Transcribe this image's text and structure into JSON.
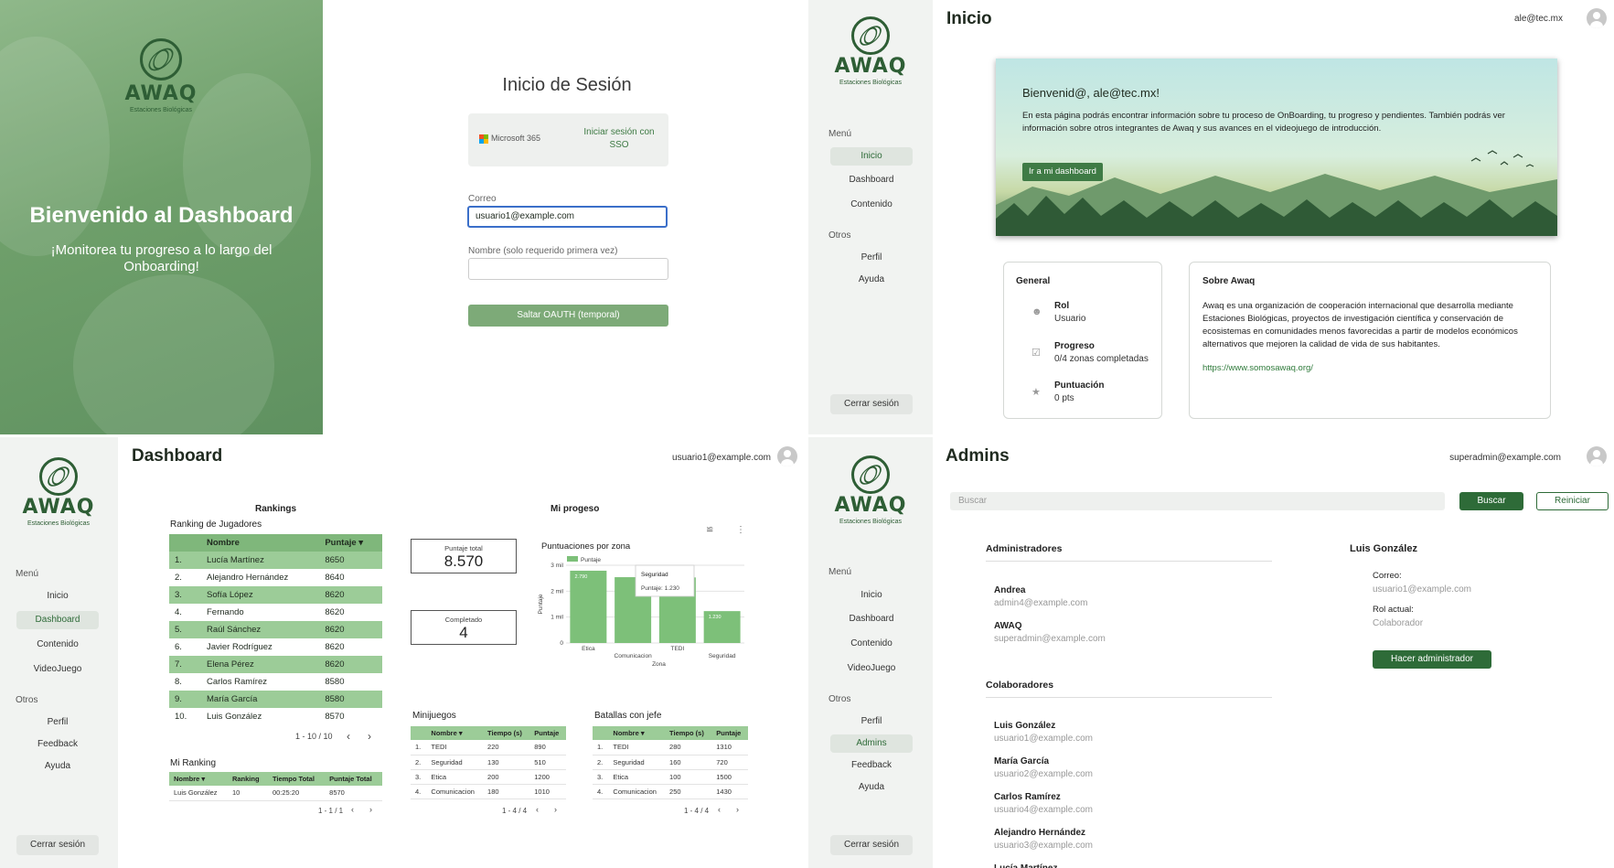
{
  "brand": {
    "name": "AWAQ",
    "tagline": "Estaciones Biológicas"
  },
  "login": {
    "hero_title": "Bienvenido al Dashboard",
    "hero_subtitle": "¡Monitorea tu progreso a lo largo del Onboarding!",
    "title": "Inicio de Sesión",
    "ms_label": "Microsoft 365",
    "sso_label": "Iniciar sesión con SSO",
    "email_label": "Correo",
    "email_value": "usuario1@example.com",
    "name_label": "Nombre (solo requerido primera vez)",
    "name_value": "",
    "skip_button": "Saltar OAUTH (temporal)"
  },
  "inicio": {
    "title": "Inicio",
    "user_email": "ale@tec.mx",
    "sidebar": {
      "menu_label": "Menú",
      "menu_items": [
        "Inicio",
        "Dashboard",
        "Contenido"
      ],
      "others_label": "Otros",
      "other_items": [
        "Perfil",
        "Ayuda"
      ],
      "logout": "Cerrar sesión"
    },
    "banner": {
      "greeting": "Bienvenid@, ale@tec.mx!",
      "text": "En esta página podrás encontrar información sobre tu proceso de OnBoarding, tu progreso y pendientes. También podrás ver información sobre otros integrantes de Awaq y sus avances en el videojuego de introducción.",
      "button": "Ir a mi dashboard"
    },
    "general": {
      "title": "General",
      "rol_label": "Rol",
      "rol_value": "Usuario",
      "progreso_label": "Progreso",
      "progreso_value": "0/4 zonas completadas",
      "puntuacion_label": "Puntuación",
      "puntuacion_value": "0 pts"
    },
    "about": {
      "title": "Sobre Awaq",
      "text": "Awaq es una organización de cooperación internacional que desarrolla mediante Estaciones Biológicas, proyectos de investigación científica y conservación de ecosistemas en comunidades menos favorecidas a partir de modelos económicos alternativos que mejoren la calidad de vida de sus habitantes.",
      "link": "https://www.somosawaq.org/"
    }
  },
  "dashboard": {
    "title": "Dashboard",
    "user_email": "usuario1@example.com",
    "sidebar": {
      "menu_label": "Menú",
      "menu_items": [
        "Inicio",
        "Dashboard",
        "Contenido",
        "VideoJuego"
      ],
      "others_label": "Otros",
      "other_items": [
        "Perfil",
        "Feedback",
        "Ayuda"
      ],
      "logout": "Cerrar sesión"
    },
    "rankings": {
      "section": "Rankings",
      "subtitle": "Ranking de Jugadores",
      "headers": [
        "Nombre",
        "Puntaje ▾"
      ],
      "rows": [
        [
          "1.",
          "Lucía Martínez",
          "8650"
        ],
        [
          "2.",
          "Alejandro Hernández",
          "8640"
        ],
        [
          "3.",
          "Sofía López",
          "8620"
        ],
        [
          "4.",
          "Fernando",
          "8620"
        ],
        [
          "5.",
          "Raúl Sánchez",
          "8620"
        ],
        [
          "6.",
          "Javier Rodríguez",
          "8620"
        ],
        [
          "7.",
          "Elena Pérez",
          "8620"
        ],
        [
          "8.",
          "Carlos Ramírez",
          "8580"
        ],
        [
          "9.",
          "María García",
          "8580"
        ],
        [
          "10.",
          "Luis González",
          "8570"
        ]
      ],
      "pager": "1 - 10 / 10"
    },
    "mi_ranking": {
      "title": "Mi Ranking",
      "headers": [
        "Nombre ▾",
        "Ranking",
        "Tiempo Total",
        "Puntaje Total"
      ],
      "rows": [
        [
          "Luis González",
          "10",
          "00:25:20",
          "8570"
        ]
      ],
      "pager": "1 - 1 / 1"
    },
    "progreso": {
      "section": "Mi progeso",
      "total_label": "Puntaje total",
      "total_value": "8.570",
      "done_label": "Completado",
      "done_value": "4"
    },
    "chart_data": {
      "type": "bar",
      "title": "Puntuaciones por zona",
      "xlabel": "Zona",
      "ylabel": "Puntaje",
      "categories": [
        "Etica",
        "Comunicacion",
        "TEDI",
        "Seguridad"
      ],
      "series": [
        {
          "name": "Puntaje",
          "values": [
            2790,
            2540,
            2530,
            1230
          ]
        }
      ],
      "ylim": [
        0,
        3000
      ],
      "yticks": [
        "0",
        "1 mil",
        "2 mil",
        "3 mil"
      ],
      "bar_labels": [
        "2.790",
        "",
        "",
        "1.230"
      ],
      "tooltip": {
        "title": "Seguridad",
        "text": "Puntaje: 1.230"
      },
      "color": "#7dc079",
      "legend": "top-left"
    },
    "minijuegos": {
      "title": "Minijuegos",
      "headers": [
        "Nombre ▾",
        "Tiempo (s)",
        "Puntaje"
      ],
      "rows": [
        [
          "1.",
          "TEDI",
          "220",
          "890"
        ],
        [
          "2.",
          "Seguridad",
          "130",
          "510"
        ],
        [
          "3.",
          "Etica",
          "200",
          "1200"
        ],
        [
          "4.",
          "Comunicacion",
          "180",
          "1010"
        ]
      ],
      "pager": "1 - 4 / 4"
    },
    "batallas": {
      "title": "Batallas con jefe",
      "headers": [
        "Nombre ▾",
        "Tiempo (s)",
        "Puntaje"
      ],
      "rows": [
        [
          "1.",
          "TEDI",
          "280",
          "1310"
        ],
        [
          "2.",
          "Seguridad",
          "160",
          "720"
        ],
        [
          "3.",
          "Etica",
          "100",
          "1500"
        ],
        [
          "4.",
          "Comunicacion",
          "250",
          "1430"
        ]
      ],
      "pager": "1 - 4 / 4"
    }
  },
  "admins": {
    "title": "Admins",
    "user_email": "superadmin@example.com",
    "sidebar": {
      "menu_label": "Menú",
      "menu_items": [
        "Inicio",
        "Dashboard",
        "Contenido",
        "VideoJuego"
      ],
      "others_label": "Otros",
      "other_items": [
        "Perfil",
        "Admins",
        "Feedback",
        "Ayuda"
      ],
      "logout": "Cerrar sesión"
    },
    "search_placeholder": "Buscar",
    "search_button": "Buscar",
    "reset_button": "Reiniciar",
    "admins_title": "Administradores",
    "admins_list": [
      {
        "name": "Andrea",
        "email": "admin4@example.com"
      },
      {
        "name": "AWAQ",
        "email": "superadmin@example.com"
      }
    ],
    "collab_title": "Colaboradores",
    "collab_list": [
      {
        "name": "Luis González",
        "email": "usuario1@example.com"
      },
      {
        "name": "María García",
        "email": "usuario2@example.com"
      },
      {
        "name": "Carlos Ramírez",
        "email": "usuario4@example.com"
      },
      {
        "name": "Alejandro Hernández",
        "email": "usuario3@example.com"
      },
      {
        "name": "Lucía Martínez",
        "email": ""
      }
    ],
    "detail": {
      "name": "Luis González",
      "email_label": "Correo:",
      "email_value": "usuario1@example.com",
      "role_label": "Rol actual:",
      "role_value": "Colaborador",
      "button": "Hacer administrador"
    }
  }
}
